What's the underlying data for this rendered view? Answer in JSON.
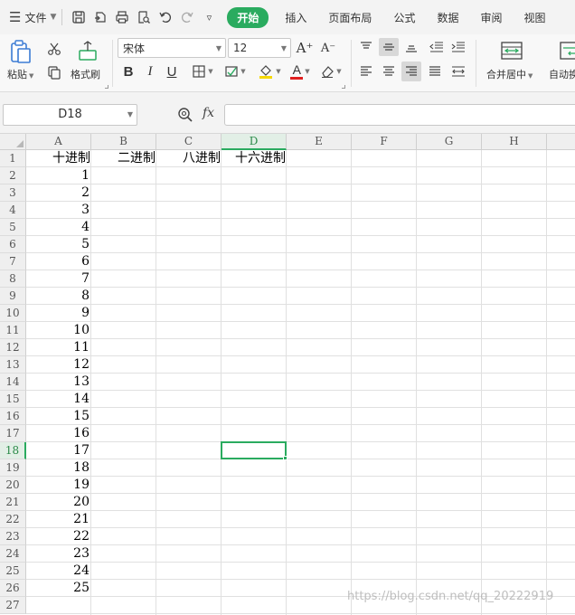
{
  "menubar": {
    "file_label": "文件",
    "tabs": [
      "开始",
      "插入",
      "页面布局",
      "公式",
      "数据",
      "审阅",
      "视图"
    ],
    "active_tab": "开始"
  },
  "ribbon": {
    "paste_label": "粘贴",
    "format_painter_label": "格式刷",
    "font_name": "宋体",
    "font_size": "12",
    "merge_center_label": "合并居中",
    "autowrap_label": "自动换",
    "bold_glyph": "B",
    "italic_glyph": "I",
    "underline_glyph": "U",
    "font_color_glyph": "A",
    "grow_glyph": "A⁺",
    "shrink_glyph": "A⁻"
  },
  "formula_bar": {
    "cell_ref": "D18",
    "fx_label": "fx",
    "formula": ""
  },
  "sheet": {
    "columns": [
      "A",
      "B",
      "C",
      "D",
      "E",
      "F",
      "G",
      "H"
    ],
    "selected_column": "D",
    "rows": [
      "1",
      "2",
      "3",
      "4",
      "5",
      "6",
      "7",
      "8",
      "9",
      "10",
      "11",
      "12",
      "13",
      "14",
      "15",
      "16",
      "17",
      "18",
      "19",
      "20",
      "21",
      "22",
      "23",
      "24",
      "25",
      "26",
      "27"
    ],
    "selected_row": "18",
    "header_row": [
      "十进制",
      "二进制",
      "八进制",
      "十六进制"
    ],
    "column_a_values": [
      "1",
      "2",
      "3",
      "4",
      "5",
      "6",
      "7",
      "8",
      "9",
      "10",
      "11",
      "12",
      "13",
      "14",
      "15",
      "16",
      "17",
      "18",
      "19",
      "20",
      "21",
      "22",
      "23",
      "24",
      "25"
    ]
  },
  "watermark": "https://blog.csdn.net/qq_20222919",
  "colors": {
    "accent": "#2aab5f",
    "font_color_bar": "#e02020",
    "highlight_bar": "#f5d800"
  }
}
